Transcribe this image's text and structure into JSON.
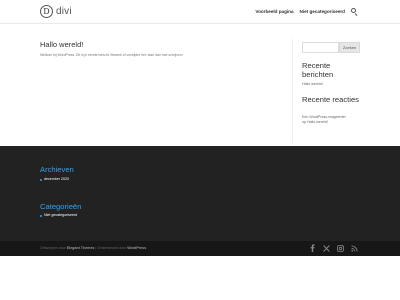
{
  "header": {
    "logo_mark": "D",
    "logo_text": "divi",
    "nav": [
      "Voorbeeld pagina",
      "Niet gecategoriseerd"
    ],
    "search_icon": "search-icon"
  },
  "post": {
    "title": "Hallo wereld!",
    "text": "Welkom bij WordPress. Dit is je eerste bericht. Bewerk of verwijder het, start dan met schrijven!"
  },
  "sidebar": {
    "search_value": "",
    "search_button": "Zoeken",
    "recent_posts_title": "Recente berichten",
    "recent_posts": [
      "Hallo wereld!"
    ],
    "recent_comments_title": "Recente reacties",
    "recent_comments": [
      "Een WordPress-reageerder",
      "op Hallo wereld!"
    ]
  },
  "footer": {
    "archives_title": "Archieven",
    "archives": [
      "december 2020"
    ],
    "categories_title": "Categorieën",
    "categories": [
      "Niet gecategoriseerd"
    ],
    "accent_color": "#2ea3f2",
    "background_color": "#222222"
  },
  "bottom_bar": {
    "credits_prefix": "Ontworpen door",
    "credits_designer": "Elegant Themes",
    "credits_separator": "|",
    "credits_middle": "Ondersteund door",
    "credits_platform": "WordPress",
    "social_icons": [
      "facebook-icon",
      "x-icon",
      "instagram-icon",
      "rss-icon"
    ]
  }
}
